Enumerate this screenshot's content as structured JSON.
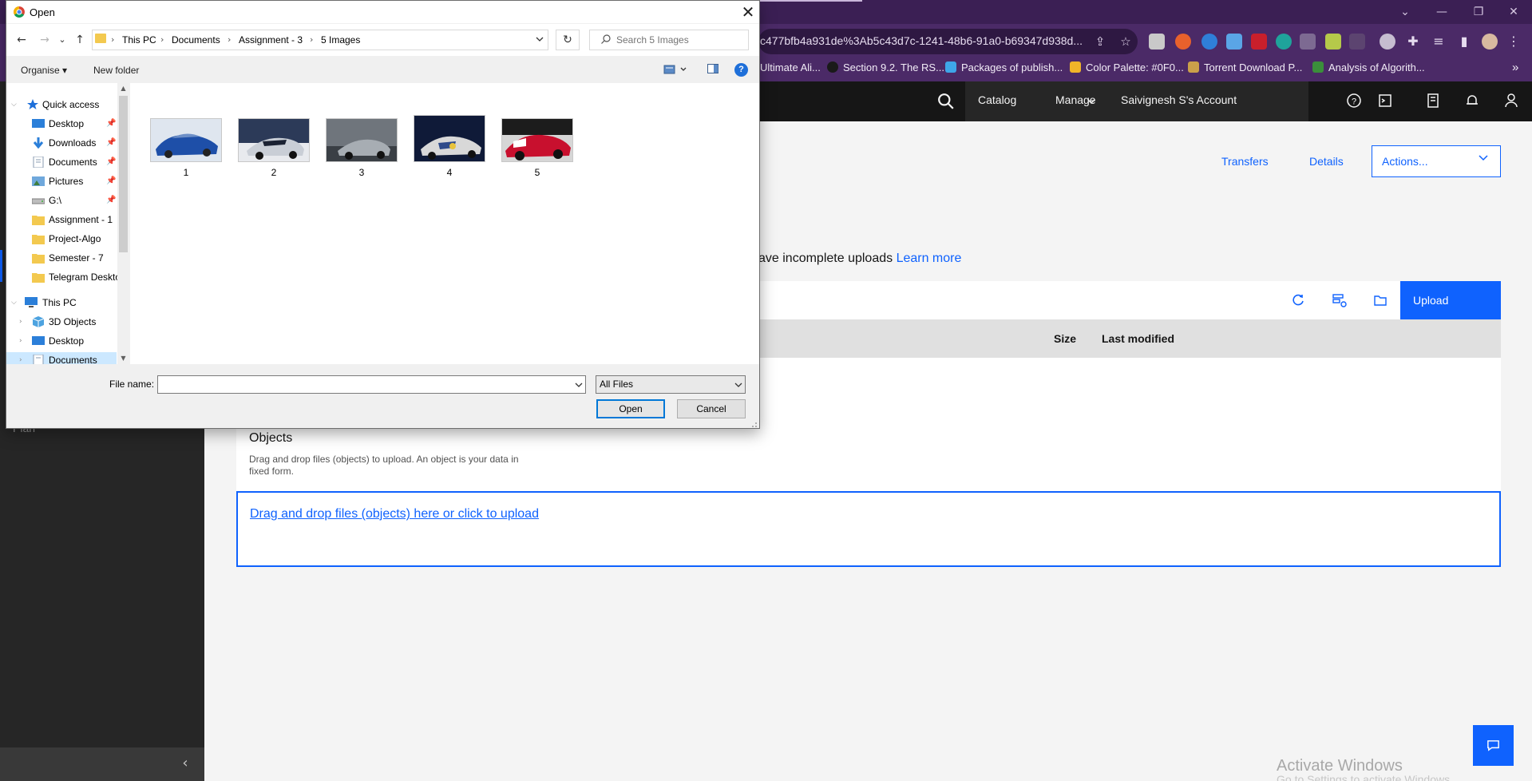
{
  "browser": {
    "url": "c477bfb4a931de%3Ab5c43d7c-1241-48b6-91a0-b69347d938d...",
    "window_controls": [
      "⌄",
      "—",
      "❐",
      "✕"
    ],
    "bookmarks": [
      {
        "label": "Ultimate Ali...",
        "icon": "bookmark-favicon",
        "color": "#e04a1f"
      },
      {
        "label": "Section 9.2. The RS...",
        "icon": "s-favicon",
        "color": "#1a1a1a"
      },
      {
        "label": "Packages of publish...",
        "icon": "flutter-favicon",
        "color": "#3ea6e8"
      },
      {
        "label": "Color Palette: #0F0...",
        "icon": "palette-favicon",
        "color": "#f0b429"
      },
      {
        "label": "Torrent Download P...",
        "icon": "torrent-favicon",
        "color": "#caa04a"
      },
      {
        "label": "Analysis of Algorith...",
        "icon": "doc-favicon",
        "color": "#3b8f3b"
      }
    ],
    "more_bookmarks": "»"
  },
  "header": {
    "catalog": "Catalog",
    "manage": "Manage",
    "account": "Saivignesh S's Account"
  },
  "bucket": {
    "transfers": "Transfers",
    "details": "Details",
    "actions": "Actions...",
    "notice": "ave incomplete uploads",
    "notice_link": "Learn more",
    "upload": "Upload",
    "col_size": "Size",
    "col_modified": "Last modified",
    "objects_title": "Objects",
    "objects_desc": "Drag and drop files (objects) to upload. An object is your data in fixed form.",
    "dropzone": "Drag and drop files (objects) here or click to upload"
  },
  "left_nav": {
    "plan_fragment": "Plan",
    "collapse": "‹"
  },
  "watermark": {
    "title": "Activate Windows",
    "subtitle": "Go to Settings to activate Windows."
  },
  "dialog": {
    "title": "Open",
    "close": "✕",
    "nav": {
      "back": "←",
      "forward": "→",
      "recent": "⌄",
      "up": "↑",
      "refresh": "↻"
    },
    "breadcrumb": [
      "This PC",
      "Documents",
      "Assignment - 3",
      "5 Images"
    ],
    "search_placeholder": "Search 5 Images",
    "organise": "Organise",
    "new_folder": "New folder",
    "help": "?",
    "tree": [
      {
        "label": "Quick access",
        "icon": "star-icon",
        "color": "#1e6fd9"
      },
      {
        "label": "Desktop",
        "icon": "desktop-icon",
        "color": "#2b7fd9",
        "pinned": true
      },
      {
        "label": "Downloads",
        "icon": "download-icon",
        "color": "#2b7fd9",
        "pinned": true
      },
      {
        "label": "Documents",
        "icon": "documents-icon",
        "color": "#8a9bb0",
        "pinned": true
      },
      {
        "label": "Pictures",
        "icon": "pictures-icon",
        "color": "#6fa8dc",
        "pinned": true
      },
      {
        "label": "G:\\",
        "icon": "drive-icon",
        "color": "#7d7d7d",
        "pinned": true
      },
      {
        "label": "Assignment - 1",
        "icon": "folder-icon",
        "color": "#f3c94f"
      },
      {
        "label": "Project-Algo",
        "icon": "folder-icon",
        "color": "#f3c94f"
      },
      {
        "label": "Semester - 7",
        "icon": "folder-icon",
        "color": "#f3c94f"
      },
      {
        "label": "Telegram Deskto",
        "icon": "folder-icon",
        "color": "#f3c94f"
      },
      {
        "label": "This PC",
        "icon": "pc-icon",
        "color": "#2b7fd9"
      },
      {
        "label": "3D Objects",
        "icon": "cube-icon",
        "color": "#4da3e0"
      },
      {
        "label": "Desktop",
        "icon": "desktop-icon",
        "color": "#2b7fd9"
      },
      {
        "label": "Documents",
        "icon": "documents-icon",
        "color": "#8a9bb0"
      }
    ],
    "files": [
      {
        "label": "1",
        "colors": [
          "#1e4fa8",
          "#6d8fc7",
          "#dfe6ef"
        ]
      },
      {
        "label": "2",
        "colors": [
          "#2c3a58",
          "#c9ced6",
          "#e8eaee"
        ]
      },
      {
        "label": "3",
        "colors": [
          "#3a3f45",
          "#a7adb3",
          "#6f757c"
        ]
      },
      {
        "label": "4",
        "colors": [
          "#0f1a38",
          "#d8d8d8",
          "#2e4a8a"
        ]
      },
      {
        "label": "5",
        "colors": [
          "#c8102e",
          "#1c1c1c",
          "#d6d6d6"
        ]
      }
    ],
    "file_name_label": "File name:",
    "file_name_value": "",
    "filter": "All Files",
    "open": "Open",
    "cancel": "Cancel"
  },
  "colors": {
    "browser_frame": "#4b2a67",
    "ibm_blue": "#0f62fe",
    "dialog_bg": "#f0f0f0"
  }
}
